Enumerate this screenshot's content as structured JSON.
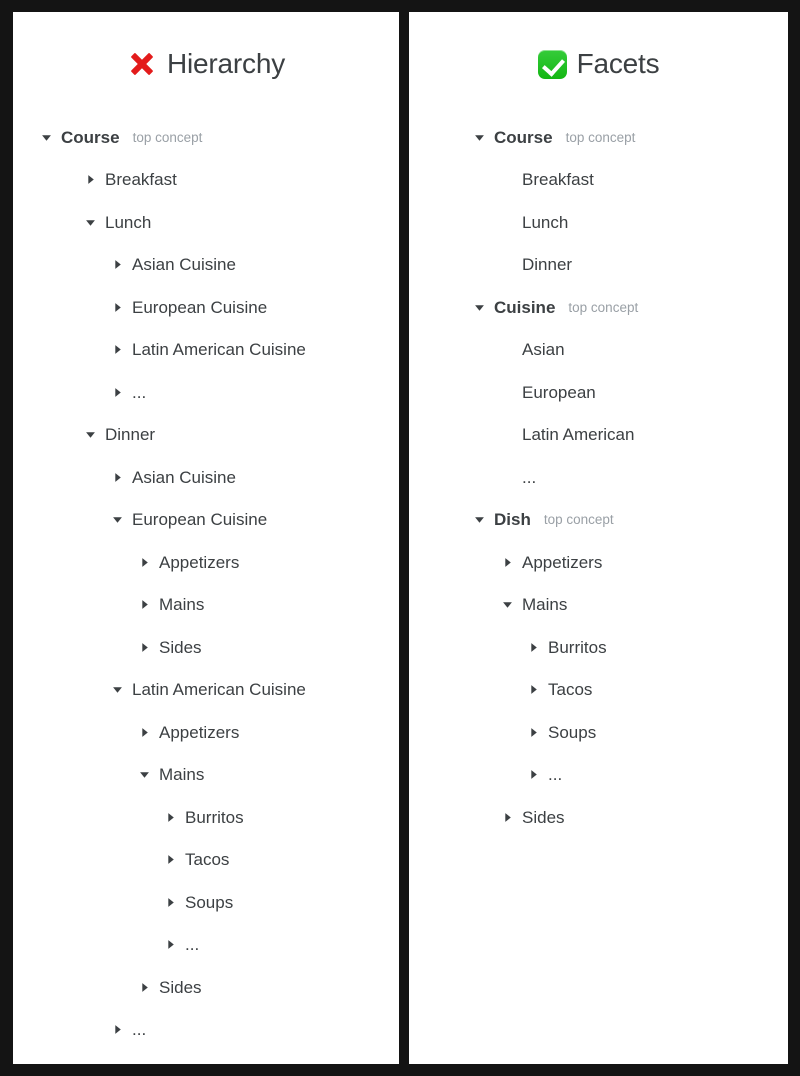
{
  "panels": [
    {
      "id": "hierarchy",
      "icon": "cross-mark-icon",
      "icon_glyph": "❌",
      "icon_color": "#e31b1b",
      "title": "Hierarchy",
      "rows": [
        {
          "level": 0,
          "marker": "down",
          "label": "Course",
          "badge": "top concept",
          "top": true
        },
        {
          "level": 1,
          "marker": "right",
          "label": "Breakfast",
          "badge": ""
        },
        {
          "level": 1,
          "marker": "down",
          "label": "Lunch",
          "badge": ""
        },
        {
          "level": 2,
          "marker": "right",
          "label": "Asian Cuisine",
          "badge": ""
        },
        {
          "level": 2,
          "marker": "right",
          "label": "European Cuisine",
          "badge": ""
        },
        {
          "level": 2,
          "marker": "right",
          "label": "Latin American Cuisine",
          "badge": ""
        },
        {
          "level": 2,
          "marker": "right",
          "label": "...",
          "badge": ""
        },
        {
          "level": 1,
          "marker": "down",
          "label": "Dinner",
          "badge": ""
        },
        {
          "level": 2,
          "marker": "right",
          "label": "Asian Cuisine",
          "badge": ""
        },
        {
          "level": 2,
          "marker": "down",
          "label": "European Cuisine",
          "badge": ""
        },
        {
          "level": 3,
          "marker": "right",
          "label": "Appetizers",
          "badge": ""
        },
        {
          "level": 3,
          "marker": "right",
          "label": "Mains",
          "badge": ""
        },
        {
          "level": 3,
          "marker": "right",
          "label": "Sides",
          "badge": ""
        },
        {
          "level": 2,
          "marker": "down",
          "label": "Latin American Cuisine",
          "badge": ""
        },
        {
          "level": 3,
          "marker": "right",
          "label": "Appetizers",
          "badge": ""
        },
        {
          "level": 3,
          "marker": "down",
          "label": "Mains",
          "badge": ""
        },
        {
          "level": 4,
          "marker": "right",
          "label": "Burritos",
          "badge": ""
        },
        {
          "level": 4,
          "marker": "right",
          "label": "Tacos",
          "badge": ""
        },
        {
          "level": 4,
          "marker": "right",
          "label": "Soups",
          "badge": ""
        },
        {
          "level": 4,
          "marker": "right",
          "label": "...",
          "badge": ""
        },
        {
          "level": 3,
          "marker": "right",
          "label": "Sides",
          "badge": ""
        },
        {
          "level": 2,
          "marker": "right",
          "label": "...",
          "badge": ""
        }
      ]
    },
    {
      "id": "facets",
      "icon": "white-check-mark-icon",
      "icon_glyph": "✅",
      "icon_color": "#14b714",
      "title": "Facets",
      "rows": [
        {
          "level": 0,
          "marker": "down",
          "label": "Course",
          "badge": "top concept",
          "top": true
        },
        {
          "level": 1,
          "marker": "none",
          "label": "Breakfast",
          "badge": ""
        },
        {
          "level": 1,
          "marker": "none",
          "label": "Lunch",
          "badge": ""
        },
        {
          "level": 1,
          "marker": "none",
          "label": "Dinner",
          "badge": ""
        },
        {
          "level": 0,
          "marker": "down",
          "label": "Cuisine",
          "badge": "top concept",
          "top": true
        },
        {
          "level": 1,
          "marker": "none",
          "label": "Asian",
          "badge": ""
        },
        {
          "level": 1,
          "marker": "none",
          "label": "European",
          "badge": ""
        },
        {
          "level": 1,
          "marker": "none",
          "label": "Latin American",
          "badge": ""
        },
        {
          "level": 1,
          "marker": "none",
          "label": "...",
          "badge": ""
        },
        {
          "level": 0,
          "marker": "down",
          "label": "Dish",
          "badge": "top concept",
          "top": true
        },
        {
          "level": 1,
          "marker": "right",
          "label": "Appetizers",
          "badge": ""
        },
        {
          "level": 1,
          "marker": "down",
          "label": "Mains",
          "badge": ""
        },
        {
          "level": 2,
          "marker": "right",
          "label": "Burritos",
          "badge": ""
        },
        {
          "level": 2,
          "marker": "right",
          "label": "Tacos",
          "badge": ""
        },
        {
          "level": 2,
          "marker": "right",
          "label": "Soups",
          "badge": ""
        },
        {
          "level": 2,
          "marker": "right",
          "label": "...",
          "badge": ""
        },
        {
          "level": 1,
          "marker": "right",
          "label": "Sides",
          "badge": ""
        }
      ]
    }
  ],
  "colors": {
    "frame": "#141414",
    "panel_bg": "#ffffff",
    "text": "#3c4043",
    "badge": "#9aa0a6",
    "cross": "#e31b1b",
    "check": "#14b714"
  }
}
